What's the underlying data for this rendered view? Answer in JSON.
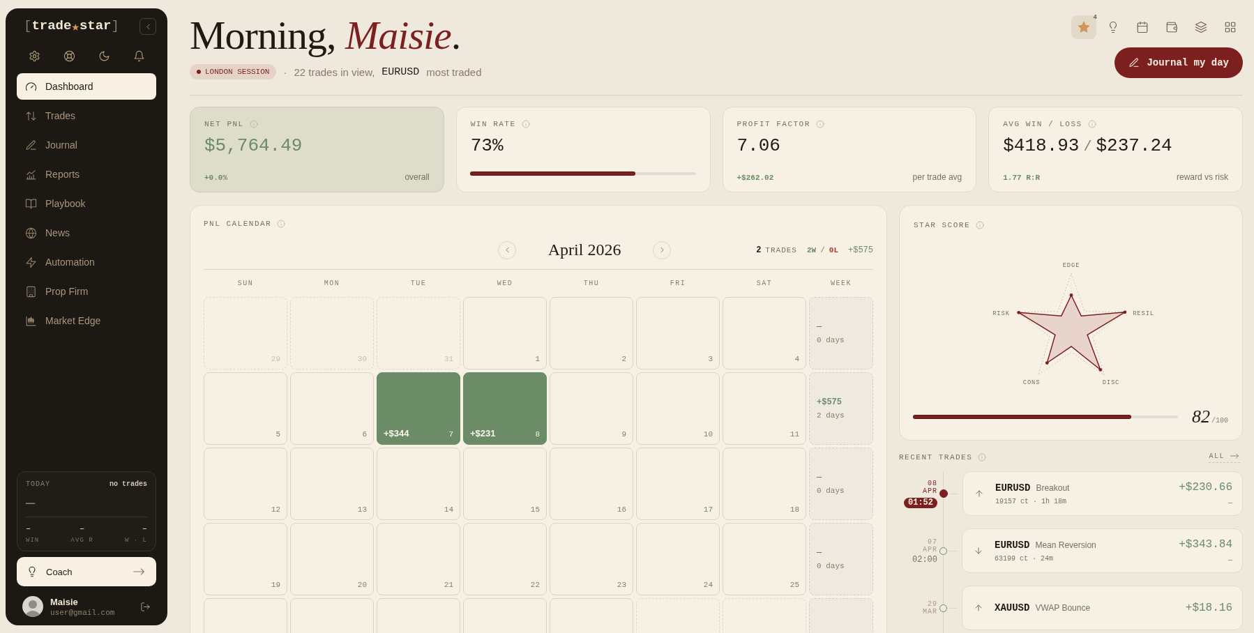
{
  "sidebar": {
    "logo": [
      {
        "kind": "bracket",
        "text": "["
      },
      {
        "kind": "word",
        "text": "trade"
      },
      {
        "kind": "mark",
        "text": "★"
      },
      {
        "kind": "word",
        "text": "star"
      },
      {
        "kind": "bracket",
        "text": "]"
      }
    ],
    "nav": [
      {
        "label": "Dashboard",
        "selected": true
      },
      {
        "label": "Trades",
        "selected": false
      },
      {
        "label": "Journal",
        "selected": false
      },
      {
        "label": "Reports",
        "selected": false
      },
      {
        "label": "Playbook",
        "selected": false
      },
      {
        "label": "News",
        "selected": false
      },
      {
        "label": "Automation",
        "selected": false
      },
      {
        "label": "Prop Firm",
        "selected": false
      },
      {
        "label": "Market Edge",
        "selected": false
      }
    ],
    "today": {
      "label": "TODAY",
      "status": "no trades",
      "value": "—",
      "stats": [
        {
          "value": "–",
          "label": "WIN"
        },
        {
          "value": "–",
          "label": "AVG R"
        },
        {
          "value": "–",
          "label": "W · L"
        }
      ]
    },
    "coach": {
      "label": "Coach"
    },
    "user": {
      "name": "Maisie",
      "email": "user@gmail.com"
    }
  },
  "header": {
    "greeting": "Morning,",
    "name": "Maisie",
    "punctuation": ".",
    "session": "LONDON SESSION",
    "separator": "·",
    "summary": "22 trades in view,",
    "symbol": "EURUSD",
    "symbol_note": "most traded",
    "badge": "4",
    "action": "Journal my day"
  },
  "stats": [
    {
      "kind": "value",
      "label": "NET PNL",
      "value": "$5,764.49",
      "highlighted": true,
      "note": "+0.0%",
      "caption": "overall"
    },
    {
      "kind": "bar",
      "label": "WIN RATE",
      "value": "73%",
      "highlighted": false,
      "level": 0.73
    },
    {
      "kind": "value",
      "label": "PROFIT FACTOR",
      "value": "7.06",
      "highlighted": false,
      "note": "+$262.02",
      "caption": "per trade avg"
    },
    {
      "kind": "ratio",
      "label": "AVG WIN / LOSS",
      "value": "$418.93",
      "separator": "/",
      "value_2": "$237.24",
      "highlighted": false,
      "note": "1.77 R:R",
      "caption": "reward vs risk"
    }
  ],
  "calendar": {
    "title": "PNL CALENDAR",
    "month": "April 2026",
    "trades": "2",
    "trades_label": "TRADES",
    "wins": "2W",
    "slash": "/",
    "losses": "0L",
    "total": "+$575",
    "weekdays": [
      "SUN",
      "MON",
      "TUE",
      "WED",
      "THU",
      "FRI",
      "SAT",
      "WEEK"
    ],
    "weeks": [
      {
        "days": [
          {
            "day": "29",
            "outside": true
          },
          {
            "day": "30",
            "outside": true
          },
          {
            "day": "31",
            "outside": true
          },
          {
            "day": "1",
            "outside": false
          },
          {
            "day": "2",
            "outside": false
          },
          {
            "day": "3",
            "outside": false
          },
          {
            "day": "4",
            "outside": false
          }
        ],
        "week": {
          "total": "—",
          "days": "0 days",
          "positive": false
        }
      },
      {
        "days": [
          {
            "day": "5",
            "outside": false
          },
          {
            "day": "6",
            "outside": false
          },
          {
            "day": "7",
            "outside": false,
            "pnl": "+$344",
            "win": true
          },
          {
            "day": "8",
            "outside": false,
            "pnl": "+$231",
            "win": true
          },
          {
            "day": "9",
            "outside": false
          },
          {
            "day": "10",
            "outside": false
          },
          {
            "day": "11",
            "outside": false
          }
        ],
        "week": {
          "total": "+$575",
          "days": "2 days",
          "positive": true
        }
      },
      {
        "days": [
          {
            "day": "12",
            "outside": false
          },
          {
            "day": "13",
            "outside": false
          },
          {
            "day": "14",
            "outside": false
          },
          {
            "day": "15",
            "outside": false
          },
          {
            "day": "16",
            "outside": false
          },
          {
            "day": "17",
            "outside": false
          },
          {
            "day": "18",
            "outside": false
          }
        ],
        "week": {
          "total": "—",
          "days": "0 days",
          "positive": false
        }
      },
      {
        "days": [
          {
            "day": "19",
            "outside": false
          },
          {
            "day": "20",
            "outside": false
          },
          {
            "day": "21",
            "outside": false
          },
          {
            "day": "22",
            "outside": false
          },
          {
            "day": "23",
            "outside": false
          },
          {
            "day": "24",
            "outside": false
          },
          {
            "day": "25",
            "outside": false
          }
        ],
        "week": {
          "total": "—",
          "days": "0 days",
          "positive": false
        }
      },
      {
        "days": [
          {
            "outside": false
          },
          {
            "outside": false
          },
          {
            "outside": false
          },
          {
            "outside": false
          },
          {
            "outside": false
          },
          {
            "outside": true
          },
          {
            "outside": true
          }
        ]
      }
    ]
  },
  "star_score": {
    "title": "STAR SCORE",
    "axes": [
      "EDGE",
      "RESIL",
      "DISC",
      "CONS",
      "RISK"
    ],
    "level": 0.82,
    "score": "82",
    "max": "/100"
  },
  "recent_trades": {
    "title": "RECENT TRADES",
    "link": "ALL",
    "trades": [
      {
        "day": "08",
        "month": "APR",
        "time": "01:52",
        "current": true,
        "long": true,
        "symbol": "EURUSD",
        "strategy": "Breakout",
        "meta": "19157 ct · 1h 18m",
        "pnl": "+$230.66",
        "sub": "–"
      },
      {
        "day": "07",
        "month": "APR",
        "time": "02:00",
        "current": false,
        "long": false,
        "symbol": "EURUSD",
        "strategy": "Mean Reversion",
        "meta": "63199 ct · 24m",
        "pnl": "+$343.84",
        "sub": "–"
      },
      {
        "day": "29",
        "month": "MAR",
        "current": false,
        "long": true,
        "symbol": "XAUUSD",
        "strategy": "VWAP Bounce",
        "pnl": "+$18.16"
      }
    ]
  }
}
